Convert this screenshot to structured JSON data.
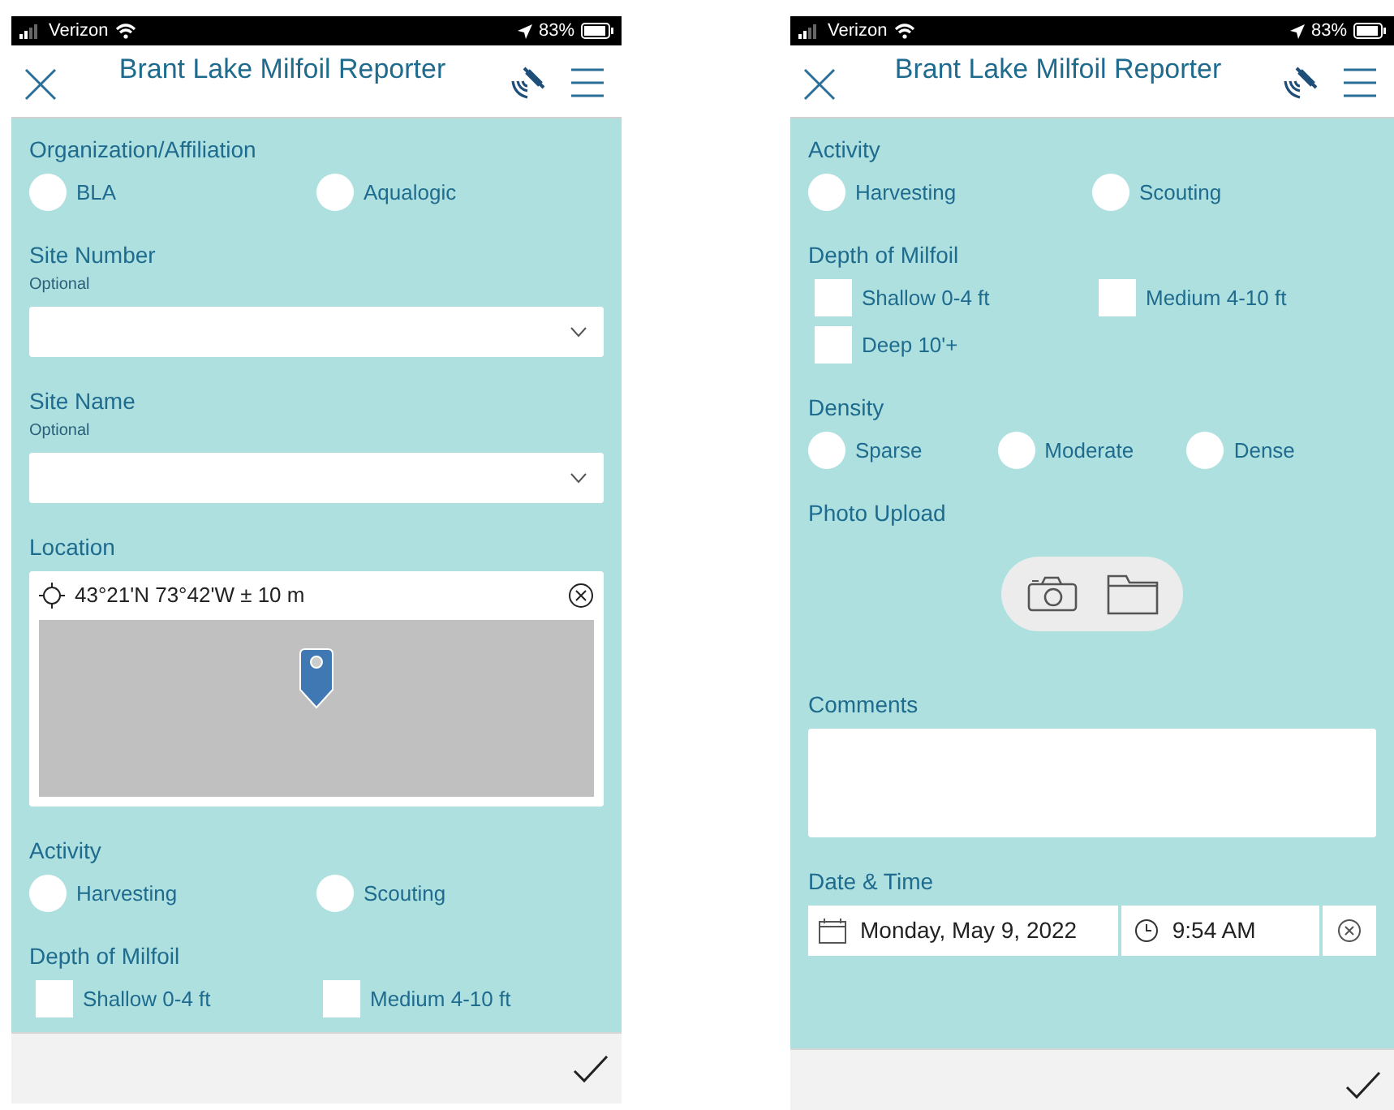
{
  "screens": [
    {
      "status_bar": {
        "carrier": "Verizon",
        "battery": "83%"
      },
      "header": {
        "title": "Brant Lake Milfoil Reporter"
      },
      "fields": [
        {
          "kind": "radio",
          "label": "Organization/Affiliation",
          "options": [
            {
              "label": "BLA",
              "selected": false
            },
            {
              "label": "Aqualogic",
              "selected": false
            }
          ]
        },
        {
          "kind": "select",
          "label": "Site Number",
          "hint": "Optional"
        },
        {
          "kind": "select",
          "label": "Site Name",
          "hint": "Optional"
        },
        {
          "kind": "location",
          "label": "Location",
          "value": "43°21'N 73°42'W ± 10 m"
        },
        {
          "kind": "radio",
          "label": "Activity",
          "options": [
            {
              "label": "Harvesting",
              "selected": false
            },
            {
              "label": "Scouting",
              "selected": false
            }
          ]
        },
        {
          "kind": "checkbox",
          "label": "Depth of Milfoil",
          "options": [
            {
              "label": "Shallow 0-4 ft",
              "checked": false
            },
            {
              "label": "Medium 4-10 ft",
              "checked": false
            }
          ]
        }
      ]
    },
    {
      "status_bar": {
        "carrier": "Verizon",
        "battery": "83%"
      },
      "header": {
        "title": "Brant Lake Milfoil Reporter"
      },
      "fields": [
        {
          "kind": "radio",
          "label": "Activity",
          "options": [
            {
              "label": "Harvesting",
              "selected": false
            },
            {
              "label": "Scouting",
              "selected": false
            }
          ]
        },
        {
          "kind": "checkbox",
          "label": "Depth of Milfoil",
          "options": [
            {
              "label": "Shallow 0-4 ft",
              "checked": false
            },
            {
              "label": "Medium 4-10 ft",
              "checked": false
            },
            {
              "label": "Deep 10'+",
              "checked": false
            }
          ]
        },
        {
          "kind": "radio",
          "label": "Density",
          "options": [
            {
              "label": "Sparse",
              "selected": false
            },
            {
              "label": "Moderate",
              "selected": false
            },
            {
              "label": "Dense",
              "selected": false
            }
          ]
        },
        {
          "kind": "photo",
          "label": "Photo Upload"
        },
        {
          "kind": "textarea",
          "label": "Comments"
        },
        {
          "kind": "datetime",
          "label": "Date & Time",
          "date": "Monday, May 9, 2022",
          "time": "9:54 AM"
        }
      ]
    }
  ]
}
